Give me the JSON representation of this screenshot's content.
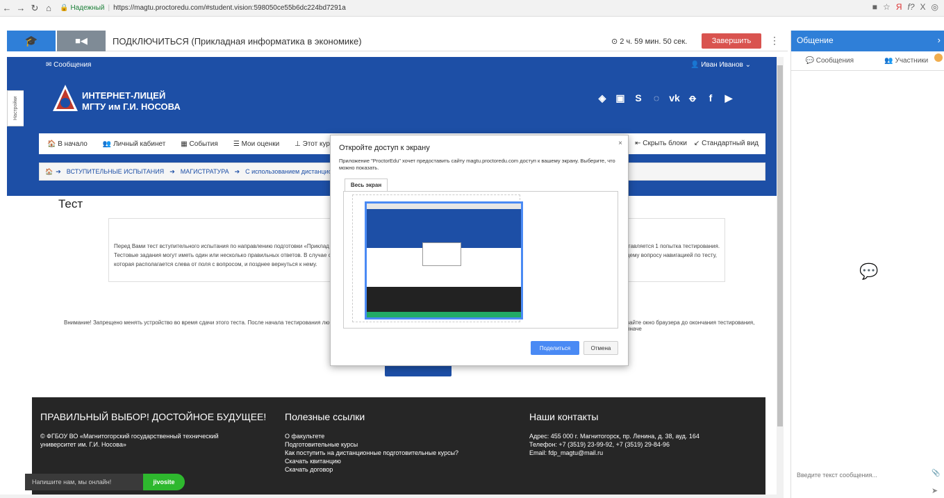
{
  "browser": {
    "secure_label": "Надежный",
    "url": "https://magtu.proctoredu.com/#student.vision:598050ce55b6dc224bd7291a"
  },
  "proctor": {
    "session_title": "ПОДКЛЮЧИТЬСЯ (Прикладная информатика в экономике)",
    "timer": "2 ч. 59 мин. 50 сек.",
    "finish_label": "Завершить"
  },
  "site": {
    "messages_link": "Сообщения",
    "user_name": "Иван Иванов",
    "settings_tab": "Настройки",
    "lyceum_name_line1": "ИНТЕРНЕТ-ЛИЦЕЙ",
    "lyceum_name_line2": "МГТУ им Г.И. НОСОВА",
    "nav": {
      "home": "В начало",
      "cabinet": "Личный кабинет",
      "events": "События",
      "grades": "Мои оценки",
      "course": "Этот кур",
      "hide_blocks": "Скрыть блоки",
      "standard_view": "Стандартный вид"
    },
    "breadcrumb": [
      "ВСТУПИТЕЛЬНЫЕ ИСПЫТАНИЯ",
      "МАГИСТРАТУРА",
      "С использованием дистанционных технологи"
    ],
    "test_title": "Тест",
    "intro_left": "Перед Вами тест вступительного испытания по направлению подготовки «Приклад Тестовые задания могут иметь один или несколько правильных ответов. В случае со которая располагается слева от поля с вопросом, и позднее вернуться к нему.",
    "intro_right": "ставляется 1 попытка тестирования. щему вопросу навигацией по тесту,",
    "warning_left": "Внимание! Запрещено менять устройство во время сдачи этого теста. После начала тестирования любые",
    "warning_right": "вайте окно браузера до окончания тестирования, иначе",
    "footer": {
      "col1_title": "ПРАВИЛЬНЫЙ ВЫБОР! ДОСТОЙНОЕ БУДУЩЕЕ!",
      "col1_text": "© ФГБОУ ВО «Магнитогорский государственный технический университет им. Г.И. Носова»",
      "col2_title": "Полезные ссылки",
      "col2_links": [
        "О факультете",
        "Подготовительные курсы",
        "Как поступить на дистанционные подготовительные курсы?",
        "Скачать квитанцию",
        "Скачать договор"
      ],
      "col3_title": "Наши контакты",
      "col3_address": "Адрес: 455 000 г. Магнитогорск, пр. Ленина, д. 38, ауд. 164",
      "col3_phone": "Телефон: +7 (3519) 23-99-92, +7 (3519) 29-84-96",
      "col3_email": "Email: fdp_magtu@mail.ru"
    },
    "jivo_text": "Напишите нам, мы онлайн!",
    "jivo_brand": "jivosite"
  },
  "chat": {
    "title": "Общение",
    "tab_messages": "Сообщения",
    "tab_participants": "Участники",
    "input_placeholder": "Введите текст сообщения..."
  },
  "dialog": {
    "title": "Откройте доступ к экрану",
    "message": "Приложение \"ProctorEdu\" хочет предоставить сайту magtu.proctoredu.com доступ к вашему экрану. Выберите, что можно показать.",
    "tab_label": "Весь экран",
    "share_label": "Поделиться",
    "cancel_label": "Отмена"
  }
}
